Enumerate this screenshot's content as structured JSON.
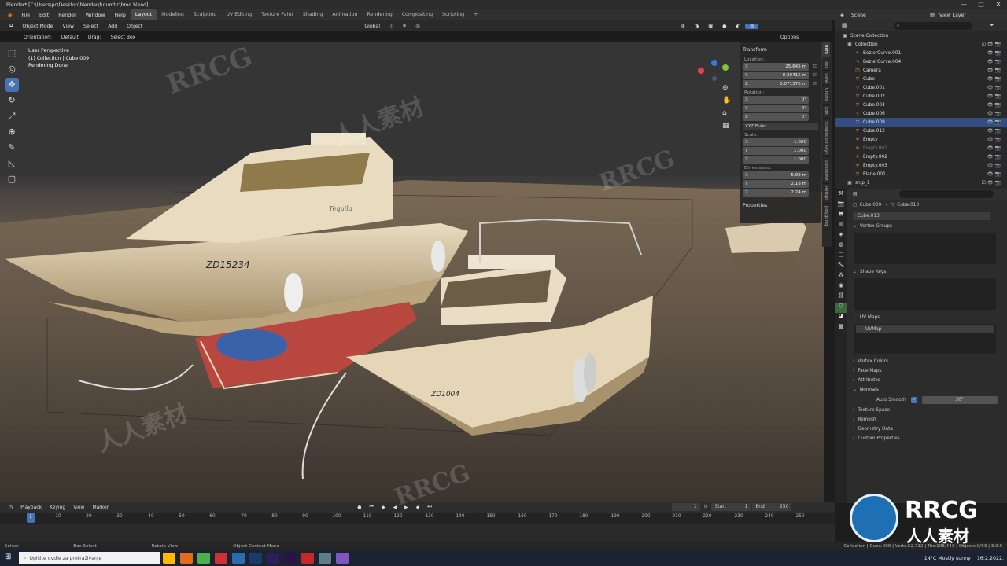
{
  "window": {
    "title": "Blender* [C:\\Users\\pc\\Desktop\\blender\\futumtic\\brod.blend]",
    "controls": [
      "—",
      "□",
      "✕"
    ]
  },
  "menu": [
    "File",
    "Edit",
    "Render",
    "Window",
    "Help"
  ],
  "workspaces": [
    "Layout",
    "Modeling",
    "Sculpting",
    "UV Editing",
    "Texture Paint",
    "Shading",
    "Animation",
    "Rendering",
    "Compositing",
    "Scripting",
    "+"
  ],
  "active_workspace": "Layout",
  "scene": {
    "scene_label": "Scene",
    "view_layer_label": "View Layer"
  },
  "viewport_header": {
    "mode": "Object Mode",
    "menus": [
      "View",
      "Select",
      "Add",
      "Object"
    ],
    "transform_orientation": "Global",
    "options_label": "Options"
  },
  "viewport_sub": {
    "orientation_label": "Orientation:",
    "orientation_value": "Default",
    "drag_label": "Drag:",
    "drag_value": "Select Box"
  },
  "viewport_info": {
    "perspective": "User Perspective",
    "collection": "(1) Collection | Cube.009",
    "status": "Rendering Done"
  },
  "tools": [
    "select-box",
    "cursor",
    "move",
    "rotate",
    "scale",
    "transform",
    "annotate",
    "measure",
    "add-cube"
  ],
  "transform_panel": {
    "title": "Transform",
    "location_label": "Location:",
    "location": [
      {
        "k": "X",
        "v": "25.645 m"
      },
      {
        "k": "Y",
        "v": "0.20415 m"
      },
      {
        "k": "Z",
        "v": "0.071375 m"
      }
    ],
    "rotation_label": "Rotation:",
    "rotation": [
      {
        "k": "X",
        "v": "0°"
      },
      {
        "k": "Y",
        "v": "0°"
      },
      {
        "k": "Z",
        "v": "0°"
      }
    ],
    "rotation_mode": "XYZ Euler",
    "scale_label": "Scale:",
    "scale": [
      {
        "k": "X",
        "v": "1.000"
      },
      {
        "k": "Y",
        "v": "1.000"
      },
      {
        "k": "Z",
        "v": "1.000"
      }
    ],
    "dimensions_label": "Dimensions:",
    "dimensions": [
      {
        "k": "X",
        "v": "5.99 m"
      },
      {
        "k": "Y",
        "v": "2.18 m"
      },
      {
        "k": "Z",
        "v": "2.24 m"
      }
    ],
    "properties_label": "Properties"
  },
  "npanel_tabs": [
    "Item",
    "Tool",
    "View",
    "Create",
    "Edit",
    "Screencast Keys",
    "BlenderKit",
    "Retopo",
    "polygoniq"
  ],
  "outliner": {
    "root": "Scene Collection",
    "collection": "Collection",
    "items": [
      "BezierCurve.001",
      "BezierCurve.004",
      "Camera",
      "Cube",
      "Cube.001",
      "Cube.002",
      "Cube.003",
      "Cube.006",
      "Cube.009",
      "Cube.012",
      "Empty",
      "Empty.001",
      "Empty.002",
      "Empty.003",
      "Plane.001"
    ],
    "extra": "ship_1"
  },
  "properties": {
    "breadcrumb_object": "Cube.009",
    "breadcrumb_mesh": "Cube.013",
    "mesh_name": "Cube.013",
    "sections": [
      "Vertex Groups",
      "Shape Keys",
      "UV Maps",
      "Vertex Colors",
      "Face Maps",
      "Attributes",
      "Normals",
      "Texture Space",
      "Remesh",
      "Geometry Data",
      "Custom Properties"
    ],
    "uv_map_name": "UVMap",
    "auto_smooth_label": "Auto Smooth",
    "auto_smooth_angle": "30°"
  },
  "timeline": {
    "menus": [
      "Playback",
      "Keying",
      "View",
      "Marker"
    ],
    "current_frame": "1",
    "start_label": "Start",
    "start": "1",
    "end_label": "End",
    "end": "250",
    "ticks": [
      "1",
      "10",
      "20",
      "30",
      "40",
      "50",
      "60",
      "70",
      "80",
      "90",
      "100",
      "110",
      "120",
      "130",
      "140",
      "150",
      "160",
      "170",
      "180",
      "190",
      "200",
      "210",
      "220",
      "230",
      "240",
      "250"
    ]
  },
  "statusbar": [
    "Select",
    "Box Select",
    "Rotate View",
    "Object Context Menu",
    "Collection | Cube.009 | Verts:52,712 | Tris:108,443 | Objects:0/93 | 3.0.0"
  ],
  "taskbar": {
    "search_placeholder": "Upišite ovdje za pretraživanje",
    "weather": "14°C  Mostly sunny",
    "time": "16:2.2022."
  },
  "boat_labels": {
    "big": "ZD15234",
    "small": "ZD1004",
    "script": "Tequila"
  },
  "watermark": {
    "brand": "RRCG",
    "cn": "人人素材"
  }
}
